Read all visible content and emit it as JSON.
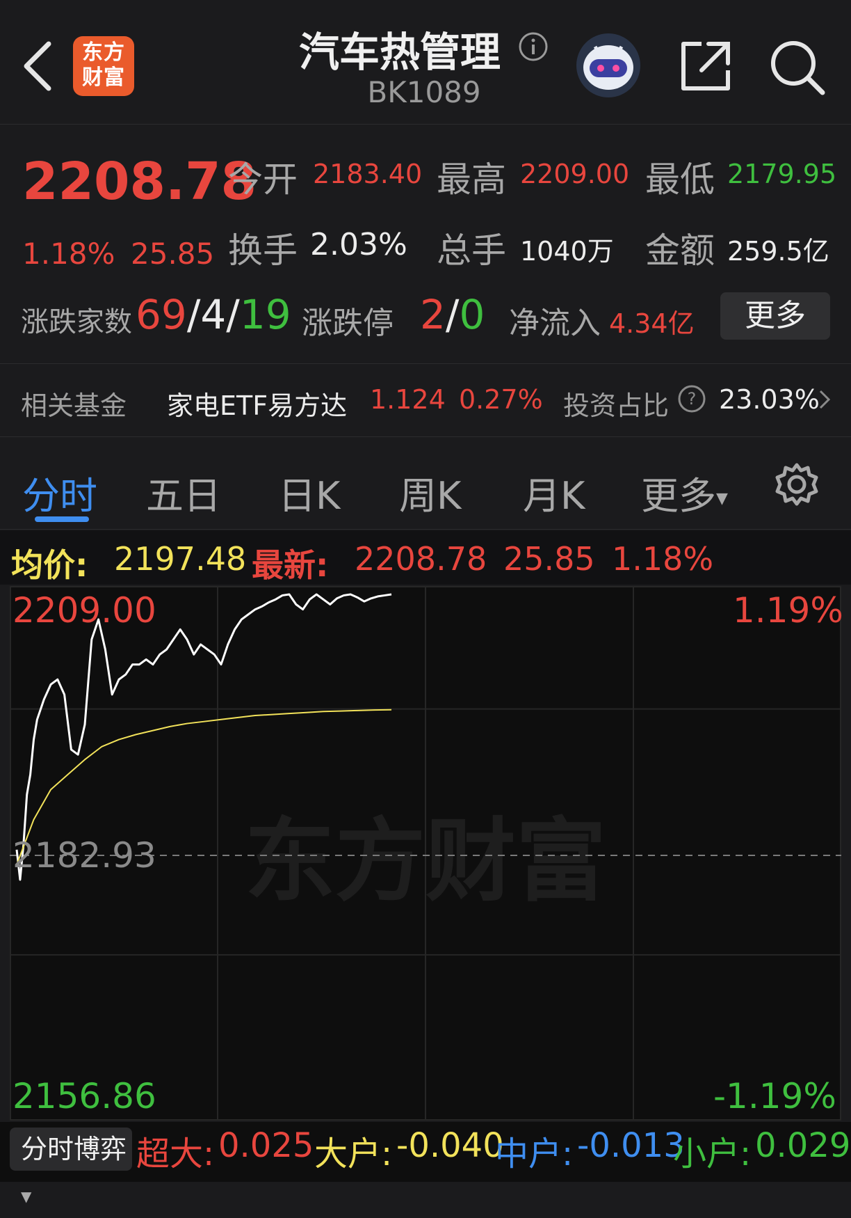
{
  "header": {
    "logo_text": "东方财富",
    "title": "汽车热管理",
    "code": "BK1089"
  },
  "quote": {
    "price": "2208.78",
    "change_pct": "1.18%",
    "change": "25.85",
    "open_label": "今开",
    "open": "2183.40",
    "high_label": "最高",
    "high": "2209.00",
    "low_label": "最低",
    "low": "2179.95",
    "turnover_label": "换手",
    "turnover": "2.03%",
    "volume_label": "总手",
    "volume": "1040万",
    "amount_label": "金额",
    "amount": "259.5亿",
    "breadth_label": "涨跌家数",
    "up": "69",
    "flat": "4",
    "down": "19",
    "limit_label": "涨跌停",
    "limit_up": "2",
    "limit_down": "0",
    "inflow_label": "净流入",
    "inflow": "4.34亿",
    "more_label": "更多"
  },
  "fund": {
    "label": "相关基金",
    "name": "家电ETF易方达",
    "price": "1.124",
    "pct": "0.27%",
    "weight_label": "投资占比",
    "weight": "23.03%"
  },
  "tabs": [
    "分时",
    "五日",
    "日K",
    "周K",
    "月K",
    "更多"
  ],
  "infobar": {
    "avg_label": "均价:",
    "avg": "2197.48",
    "latest_label": "最新:",
    "latest": "2208.78",
    "change": "25.85",
    "pct": "1.18%"
  },
  "chart_data": {
    "type": "line",
    "title": "",
    "y_top": "2209.00",
    "y_mid": "2182.93",
    "y_bottom": "2156.86",
    "pct_top": "1.19%",
    "pct_bottom": "-1.19%",
    "ylim": [
      2156.86,
      2209.0
    ],
    "baseline": 2182.93,
    "watermark": "东方财富",
    "series": [
      {
        "color": "#ffffff",
        "x": [
          0,
          1,
          2,
          3,
          4,
          5,
          6,
          8,
          10,
          12,
          14,
          16,
          18,
          20,
          22,
          24,
          26,
          28,
          30,
          32,
          34,
          36,
          38,
          40,
          42,
          44,
          46,
          48,
          50,
          52,
          54,
          56,
          58,
          60,
          62,
          64,
          66,
          68,
          70,
          72,
          74,
          76,
          78,
          80,
          82,
          84,
          86,
          88,
          90,
          92,
          94,
          96,
          98,
          100,
          102,
          104,
          106,
          108,
          110
        ],
        "values": [
          2183.5,
          2180.5,
          2184.0,
          2189.0,
          2191.0,
          2194.5,
          2196.5,
          2198.5,
          2200.0,
          2200.5,
          2199.0,
          2193.5,
          2193.0,
          2196.0,
          2204.5,
          2206.5,
          2203.5,
          2199.0,
          2200.5,
          2201.0,
          2202.0,
          2202.0,
          2202.5,
          2202.0,
          2203.0,
          2203.5,
          2204.5,
          2205.5,
          2204.5,
          2203.0,
          2204.0,
          2203.5,
          2203.0,
          2202.0,
          2204.0,
          2205.5,
          2206.5,
          2207.0,
          2207.5,
          2207.8,
          2208.2,
          2208.5,
          2208.9,
          2209.0,
          2208.0,
          2207.5,
          2208.5,
          2209.0,
          2208.5,
          2208.0,
          2208.6,
          2208.9,
          2209.0,
          2208.7,
          2208.3,
          2208.6,
          2208.8,
          2208.9,
          2209.0
        ]
      },
      {
        "color": "#f2e25a",
        "x": [
          0,
          5,
          10,
          15,
          20,
          25,
          30,
          35,
          40,
          45,
          50,
          55,
          60,
          65,
          70,
          75,
          80,
          85,
          90,
          95,
          100,
          105,
          110
        ],
        "values": [
          2182.0,
          2186.5,
          2189.5,
          2191.0,
          2192.5,
          2193.8,
          2194.5,
          2195.0,
          2195.4,
          2195.8,
          2196.1,
          2196.3,
          2196.5,
          2196.7,
          2196.9,
          2197.0,
          2197.1,
          2197.2,
          2197.3,
          2197.35,
          2197.4,
          2197.45,
          2197.48
        ]
      }
    ]
  },
  "bottom": {
    "boyi_label": "分时博弈",
    "super_label": "超大:",
    "super": "0.025",
    "large_label": "大户:",
    "large": "-0.040",
    "mid_label": "中户:",
    "mid": "-0.013",
    "small_label": "小户:",
    "small": "0.029"
  }
}
